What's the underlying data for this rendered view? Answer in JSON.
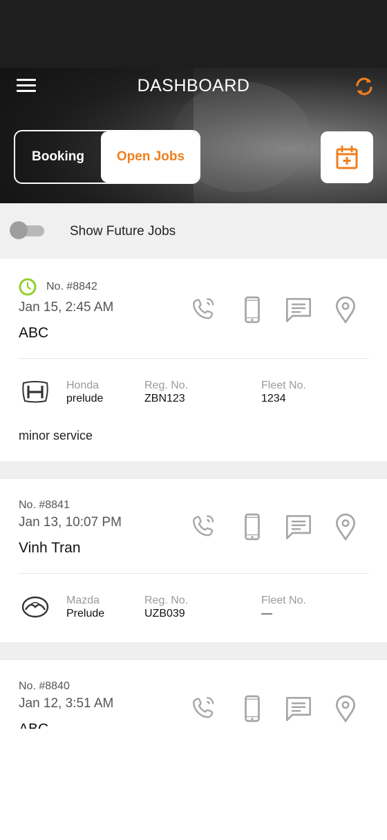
{
  "header": {
    "title": "DASHBOARD",
    "menu_icon": "hamburger-menu-icon",
    "refresh_icon": "refresh-icon",
    "accent_color": "#f07e1e"
  },
  "tabs": [
    {
      "label": "Booking",
      "selected": false
    },
    {
      "label": "Open Jobs",
      "selected": true
    }
  ],
  "calendar_icon": "calendar-add-icon",
  "filter": {
    "label": "Show Future Jobs",
    "enabled": false
  },
  "labels": {
    "reg": "Reg. No.",
    "fleet": "Fleet No."
  },
  "jobs": [
    {
      "number": "No. #8842",
      "date": "Jan 15, 2:45 AM",
      "customer": "ABC",
      "make": "Honda",
      "model": "prelude",
      "reg": "ZBN123",
      "fleet": "1234",
      "notes": "minor service",
      "status_icon": "clock-icon"
    },
    {
      "number": "No. #8841",
      "date": "Jan 13, 10:07 PM",
      "customer": "Vinh Tran",
      "make": "Mazda",
      "model": "Prelude",
      "reg": "UZB039",
      "fleet": "—"
    },
    {
      "number": "No. #8840",
      "date": "Jan 12, 3:51 AM",
      "customer": "ABC"
    }
  ],
  "action_icons": [
    "phone-call-icon",
    "mobile-icon",
    "message-icon",
    "location-icon"
  ]
}
